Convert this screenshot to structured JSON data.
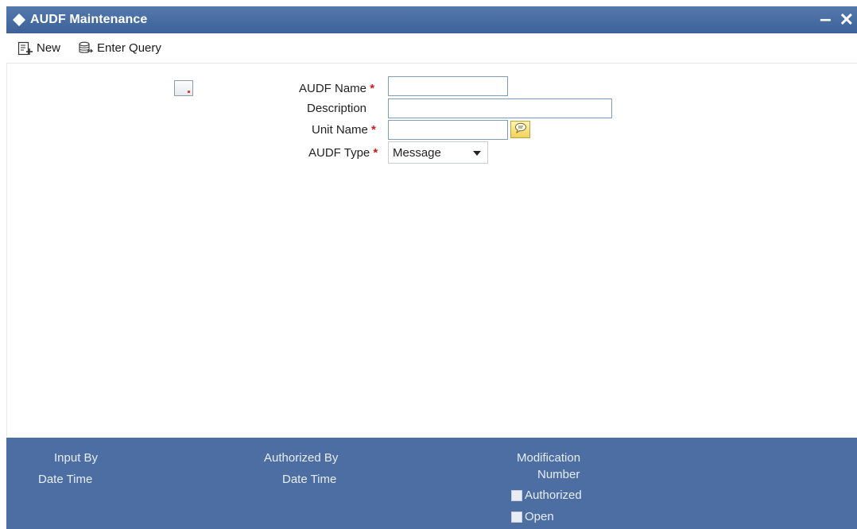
{
  "window": {
    "title": "AUDF Maintenance",
    "minimize_label": "–",
    "close_label": "✕"
  },
  "toolbar": {
    "new_label": "New",
    "enter_query_label": "Enter Query"
  },
  "form": {
    "audf_name": {
      "label": "AUDF Name",
      "required": "*",
      "value": ""
    },
    "description": {
      "label": "Description",
      "value": ""
    },
    "unit_name": {
      "label": "Unit Name",
      "required": "*",
      "value": ""
    },
    "audf_type": {
      "label": "AUDF Type",
      "required": "*",
      "selected": "Message"
    }
  },
  "footer": {
    "input_by": "Input By",
    "input_date_time": "Date Time",
    "authorized_by": "Authorized By",
    "authorized_date_time": "Date Time",
    "modification": "Modification",
    "number": "Number",
    "authorized_checkbox": "Authorized",
    "open_checkbox": "Open"
  },
  "colors": {
    "titlebar": "#4a6fa5",
    "footer": "#4d6ea3",
    "required": "#d21a1a"
  }
}
